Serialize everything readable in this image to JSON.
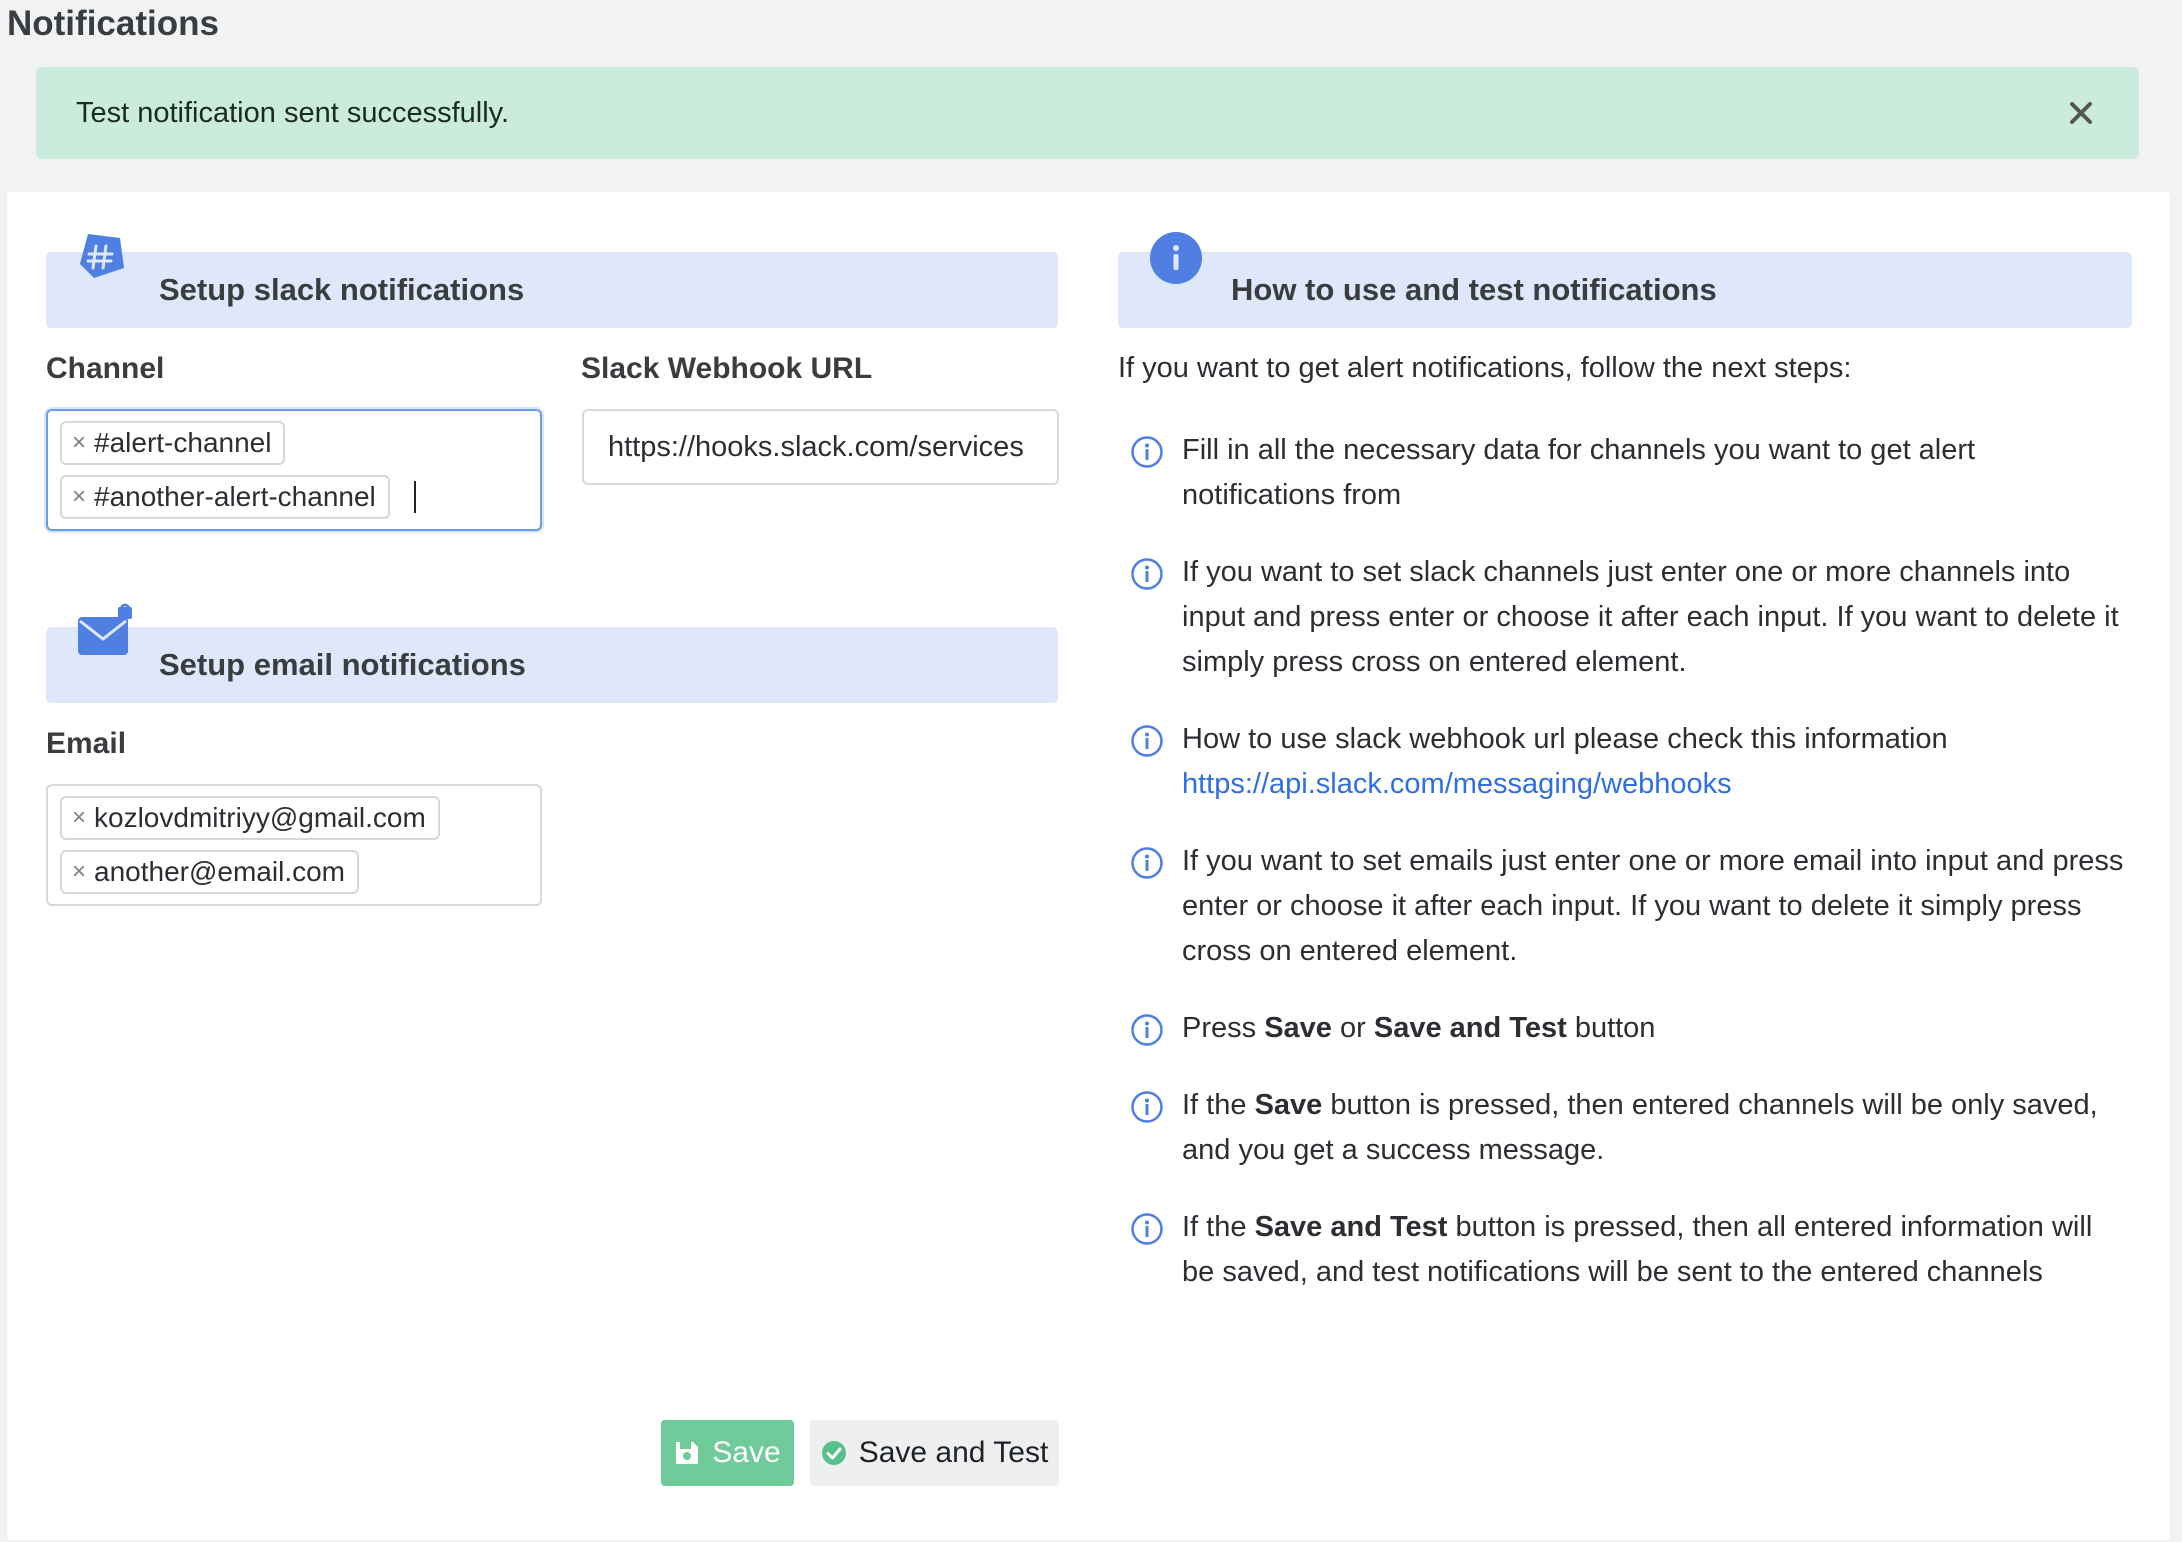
{
  "page": {
    "title": "Notifications"
  },
  "alert": {
    "message": "Test notification sent successfully.",
    "close_icon": "close-icon"
  },
  "slack_section": {
    "title": "Setup slack notifications",
    "icon": "slack-hash-icon",
    "channel_label": "Channel",
    "channels": [
      "#alert-channel",
      "#another-alert-channel"
    ],
    "webhook_label": "Slack Webhook URL",
    "webhook_value": "https://hooks.slack.com/services"
  },
  "email_section": {
    "title": "Setup email notifications",
    "icon": "envelope-icon",
    "email_label": "Email",
    "emails": [
      "kozlovdmitriyy@gmail.com",
      "another@email.com"
    ]
  },
  "buttons": {
    "save_label": "Save",
    "save_test_label": "Save and Test"
  },
  "help": {
    "title": "How to use and test notifications",
    "icon": "info-icon",
    "intro": "If you want to get alert notifications, follow the next steps:",
    "steps": {
      "s1": "Fill in all the necessary data for channels you want to get alert notifications from",
      "s2": "If you want to set slack channels just enter one or more channels into input and press enter or choose it after each input. If you want to delete it simply press cross on entered element.",
      "s3_text": "How to use slack webhook url please check this information",
      "s3_link": "https://api.slack.com/messaging/webhooks",
      "s4": "If you want to set emails just enter one or more email into input and press enter or choose it after each input. If you want to delete it simply press cross on entered element.",
      "s5_a": "Press",
      "s5_b": "Save",
      "s5_c": "or",
      "s5_d": "Save and Test",
      "s5_e": "button",
      "s6_a": "If the",
      "s6_b": "Save",
      "s6_c": "button is pressed, then entered channels will be only saved, and you get a success message.",
      "s7_a": "If the",
      "s7_b": "Save and Test",
      "s7_c": "button is pressed, then all entered information will be saved, and test notifications will be sent to the entered channels"
    }
  },
  "colors": {
    "accent": "#4f84e6",
    "header_bg": "#dfe7fa",
    "success_bg": "#cbecdc",
    "save_green": "#6fcb99",
    "link": "#2f6fdf"
  }
}
